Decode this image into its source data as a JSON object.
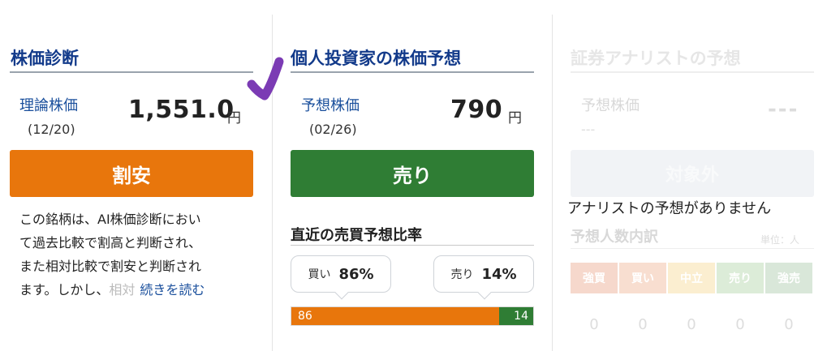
{
  "diagnosis": {
    "title": "株価診断",
    "label": "理論株価",
    "date": "(12/20)",
    "value": "1,551.0",
    "unit": "円",
    "verdict": "割安",
    "desc_lines": [
      "この銘柄は、AI株価診断におい",
      "て過去比較で割高と判断され、",
      "また相対比較で割安と判断され"
    ],
    "desc_last": "ます。しかし、",
    "desc_faded": "相対",
    "more_link": "続きを読む",
    "verdict_color": "#e8760c"
  },
  "individual": {
    "title": "個人投資家の株価予想",
    "label": "予想株価",
    "date": "(02/26)",
    "value": "790",
    "unit": "円",
    "verdict": "売り",
    "verdict_color": "#2f7d34",
    "ratio_title": "直近の売買予想比率",
    "buy": {
      "label": "買い",
      "value": "86%"
    },
    "sell": {
      "label": "売り",
      "value": "14%"
    },
    "bar": {
      "buy": 86,
      "sell": 14,
      "buy_text": "86",
      "sell_text": "14"
    }
  },
  "analyst": {
    "title": "証券アナリストの予想",
    "label": "予想株価",
    "value": "---",
    "date": "---",
    "verdict": "対象外",
    "overlay": "アナリストの予想がありません",
    "breakdown_title": "予想人数内訳",
    "unit_note": "単位：人",
    "levels": [
      {
        "label": "強買",
        "color": "#f6d8cc"
      },
      {
        "label": "買い",
        "color": "#f8ded0"
      },
      {
        "label": "中立",
        "color": "#fbeed0"
      },
      {
        "label": "売り",
        "color": "#dcecd8"
      },
      {
        "label": "強売",
        "color": "#d9e7d9"
      }
    ],
    "counts": [
      "0",
      "0",
      "0",
      "0",
      "0"
    ]
  },
  "icons": {
    "check": "checkmark-icon"
  }
}
